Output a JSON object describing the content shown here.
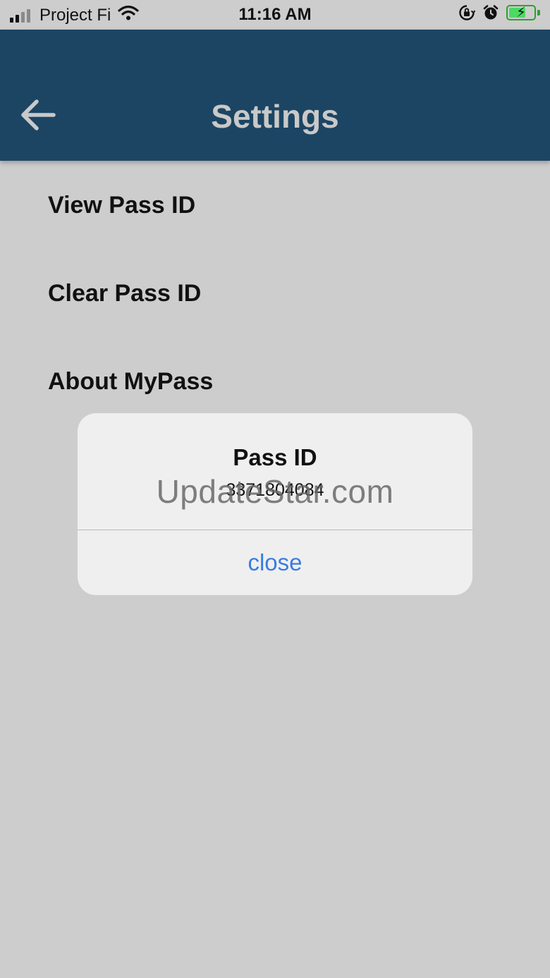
{
  "status_bar": {
    "carrier": "Project Fi",
    "time": "11:16 AM",
    "icons": [
      "signal-icon",
      "wifi-icon",
      "orientation-lock-icon",
      "alarm-icon",
      "battery-charging-icon"
    ]
  },
  "header": {
    "title": "Settings",
    "background_color": "#1c4564",
    "back_icon": "arrow-left-icon"
  },
  "menu": {
    "items": [
      {
        "label": "View Pass ID"
      },
      {
        "label": "Clear Pass ID"
      },
      {
        "label": "About MyPass"
      }
    ]
  },
  "alert": {
    "title": "Pass ID",
    "message": "3371804084",
    "close_label": "close",
    "button_color": "#3a7de0"
  },
  "watermark": {
    "text": "UpdateStar.com"
  }
}
